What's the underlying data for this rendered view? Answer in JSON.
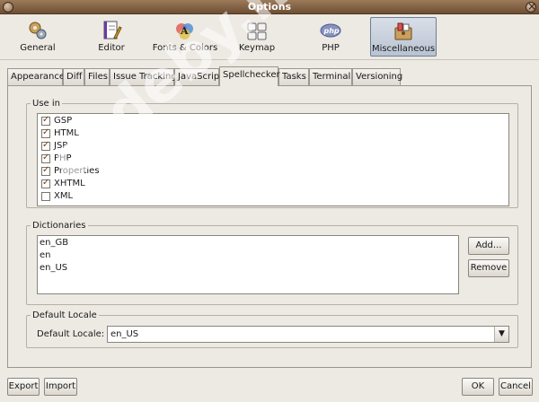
{
  "window": {
    "title": "Options"
  },
  "categories": [
    {
      "label": "General",
      "icon": "gears-icon"
    },
    {
      "label": "Editor",
      "icon": "editor-icon"
    },
    {
      "label": "Fonts & Colors",
      "icon": "fonts-colors-icon"
    },
    {
      "label": "Keymap",
      "icon": "keymap-icon"
    },
    {
      "label": "PHP",
      "icon": "php-icon"
    },
    {
      "label": "Miscellaneous",
      "icon": "miscellaneous-icon",
      "selected": true
    }
  ],
  "tabs": [
    {
      "label": "Appearance"
    },
    {
      "label": "Diff"
    },
    {
      "label": "Files"
    },
    {
      "label": "Issue Tracking"
    },
    {
      "label": "JavaScript"
    },
    {
      "label": "Spellchecker",
      "selected": true
    },
    {
      "label": "Tasks"
    },
    {
      "label": "Terminal"
    },
    {
      "label": "Versioning"
    }
  ],
  "use_in": {
    "legend": "Use in",
    "items": [
      {
        "label": "GSP",
        "checked": true
      },
      {
        "label": "HTML",
        "checked": true
      },
      {
        "label": "JSP",
        "checked": true
      },
      {
        "label": "PHP",
        "checked": true
      },
      {
        "label": "Properties",
        "checked": true
      },
      {
        "label": "XHTML",
        "checked": true
      },
      {
        "label": "XML",
        "checked": false
      }
    ]
  },
  "dictionaries": {
    "legend": "Dictionaries",
    "items": [
      "en_GB",
      "en",
      "en_US"
    ],
    "add_label": "Add...",
    "remove_label": "Remove"
  },
  "default_locale": {
    "legend": "Default Locale",
    "label": "Default Locale:",
    "value": "en_US"
  },
  "footer": {
    "export_label": "Export",
    "import_label": "Import",
    "ok_label": "OK",
    "cancel_label": "Cancel"
  },
  "watermark": "codeby.net"
}
